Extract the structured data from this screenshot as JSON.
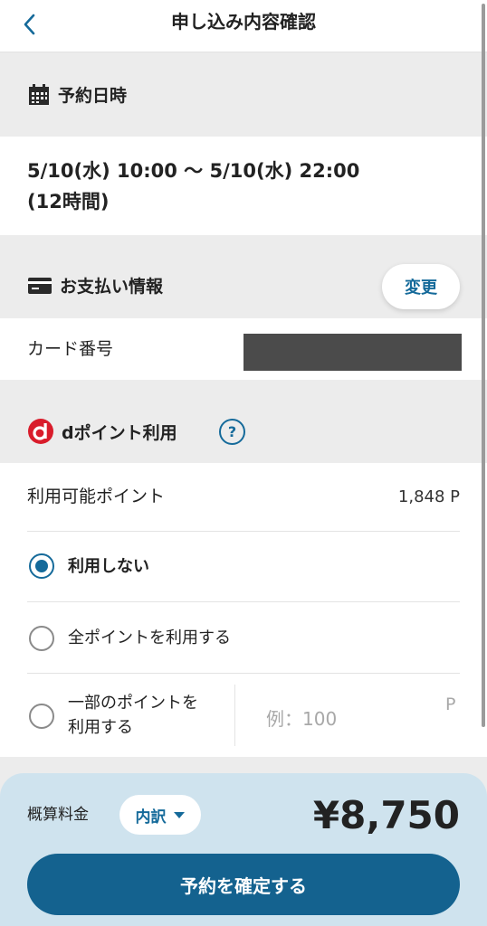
{
  "header": {
    "title": "申し込み内容確認",
    "back_icon": "chevron-left-icon"
  },
  "reservation": {
    "heading": "予約日時",
    "icon": "calendar-icon",
    "datetime_line1": "5/10(水) 10:00 〜 5/10(水) 22:00",
    "datetime_line2": "(12時間)"
  },
  "payment": {
    "heading": "お支払い情報",
    "icon": "credit-card-icon",
    "change_label": "変更",
    "card_label": "カード番号"
  },
  "dpoint": {
    "heading": "dポイント利用",
    "icon": "d-point-logo-icon",
    "help_label": "?",
    "available_label": "利用可能ポイント",
    "available_value": "1,848 P",
    "options": [
      {
        "label": "利用しない",
        "selected": true
      },
      {
        "label": "全ポイントを利用する",
        "selected": false
      },
      {
        "label_line1": "一部のポイントを",
        "label_line2": "利用する",
        "selected": false
      }
    ],
    "input_placeholder": "例：100",
    "input_unit": "P"
  },
  "footer": {
    "fee_label": "概算料金",
    "detail_label": "内訳",
    "price": "¥8,750",
    "confirm_label": "予約を確定する"
  },
  "colors": {
    "accent": "#156a9a",
    "confirm_button": "#14628f",
    "dpoint_red": "#d91c2b",
    "footer_bg": "#cfe3ee"
  }
}
